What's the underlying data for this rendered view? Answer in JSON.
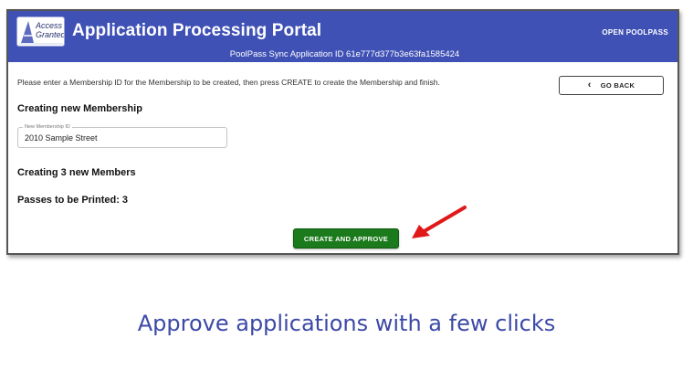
{
  "app": {
    "logo": {
      "line1": "Access",
      "line2": "Granted"
    },
    "title": "Application Processing Portal",
    "subtitle": "PoolPass Sync Application ID 61e777d377b3e63fa1585424",
    "open_link": "OPEN POOLPASS",
    "colors": {
      "appbar": "#3f51b5",
      "approve": "#1b7a1b",
      "arrow": "#e01818",
      "caption": "#3b49a7"
    }
  },
  "content": {
    "instructions": "Please enter a Membership ID for the Membership to be created, then press CREATE to create the Membership and finish.",
    "go_back_label": "GO BACK",
    "membership_heading": "Creating new Membership",
    "membership_field": {
      "label": "New Membership ID",
      "value": "2010 Sample Street"
    },
    "members_heading": "Creating 3 new Members",
    "passes_heading": "Passes to be Printed: 3",
    "approve_label": "CREATE AND APPROVE"
  },
  "caption": "Approve applications with a few clicks"
}
